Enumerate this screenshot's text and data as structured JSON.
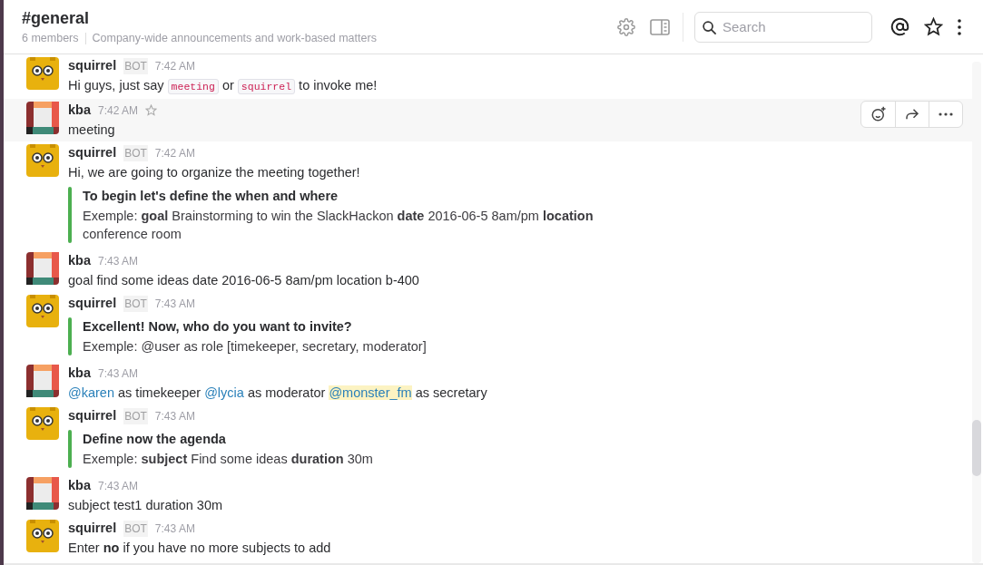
{
  "channel": {
    "name": "#general",
    "members": "6 members",
    "topic": "Company-wide announcements and work-based matters"
  },
  "search": {
    "placeholder": "Search"
  },
  "messages": [
    {
      "kind": "bot",
      "author": "squirrel",
      "badge": "BOT",
      "time": "7:42 AM",
      "hovered": false,
      "parts": [
        {
          "kind": "text",
          "text": "Hi guys, just say "
        },
        {
          "kind": "code",
          "text": "meeting"
        },
        {
          "kind": "text",
          "text": " or "
        },
        {
          "kind": "code",
          "text": "squirrel"
        },
        {
          "kind": "text",
          "text": " to invoke me!"
        }
      ]
    },
    {
      "kind": "user",
      "author": "kba",
      "time": "7:42 AM",
      "hovered": true,
      "parts": [
        {
          "kind": "text",
          "text": "meeting"
        }
      ]
    },
    {
      "kind": "bot",
      "author": "squirrel",
      "badge": "BOT",
      "time": "7:42 AM",
      "hovered": false,
      "parts": [
        {
          "kind": "text",
          "text": "Hi, we are going to organize the meeting together!"
        }
      ],
      "attachment": {
        "color": "#4caf50",
        "title": "To begin let's define the when and where",
        "text": "Exemple: **goal** Brainstorming to win the SlackHackon **date** 2016-06-5 8am/pm **location** conference room"
      }
    },
    {
      "kind": "user",
      "author": "kba",
      "time": "7:43 AM",
      "hovered": false,
      "parts": [
        {
          "kind": "text",
          "text": "goal find some ideas date 2016-06-5 8am/pm location b-400"
        }
      ]
    },
    {
      "kind": "bot",
      "author": "squirrel",
      "badge": "BOT",
      "time": "7:43 AM",
      "hovered": false,
      "attachment": {
        "color": "#4caf50",
        "title": "Excellent! Now, who do you want to invite?",
        "text": "Exemple: @user as role [timekeeper, secretary, moderator]"
      }
    },
    {
      "kind": "user",
      "author": "kba",
      "time": "7:43 AM",
      "hovered": false,
      "parts": [
        {
          "kind": "mention",
          "text": "@karen",
          "highlighted": false
        },
        {
          "kind": "text",
          "text": " as timekeeper "
        },
        {
          "kind": "mention",
          "text": "@lycia",
          "highlighted": false
        },
        {
          "kind": "text",
          "text": " as moderator "
        },
        {
          "kind": "mention",
          "text": "@monster_fm",
          "highlighted": true
        },
        {
          "kind": "text",
          "text": " as secretary"
        }
      ]
    },
    {
      "kind": "bot",
      "author": "squirrel",
      "badge": "BOT",
      "time": "7:43 AM",
      "hovered": false,
      "attachment": {
        "color": "#4caf50",
        "title": "Define now the agenda",
        "text": "Exemple: **subject** Find some ideas **duration** 30m"
      }
    },
    {
      "kind": "user",
      "author": "kba",
      "time": "7:43 AM",
      "hovered": false,
      "parts": [
        {
          "kind": "text",
          "text": "subject test1 duration 30m"
        }
      ]
    },
    {
      "kind": "bot",
      "author": "squirrel",
      "badge": "BOT",
      "time": "7:43 AM",
      "hovered": false,
      "parts": [
        {
          "kind": "text",
          "text": "Enter "
        },
        {
          "kind": "bold",
          "text": "no"
        },
        {
          "kind": "text",
          "text": " if you have no more subjects to add"
        }
      ]
    }
  ]
}
